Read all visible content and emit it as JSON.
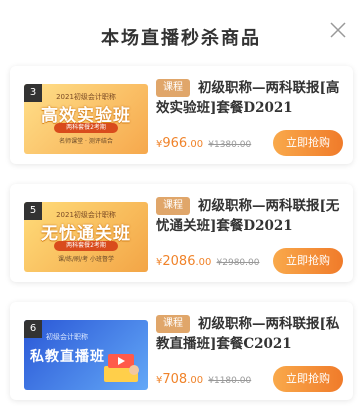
{
  "header": {
    "title": "本场直播秒杀商品"
  },
  "colors": {
    "accent": "#f0832a",
    "tag_bg": "#e0a66a",
    "button_start": "#f9a94b",
    "button_end": "#f07b2a"
  },
  "products": [
    {
      "index": "3",
      "thumb_line1": "2021初级会计职称",
      "thumb_main": "高效实验班",
      "thumb_pill": "两科套餐2考期",
      "thumb_sub": "名师课堂 · 测评结合",
      "thumb_colors": [
        "#ffd36a",
        "#f7a64a"
      ],
      "thumb_main_color": "#f2b21a",
      "tag": "课程",
      "name": "初级职称—两科联报[高效实验班]套餐D2021",
      "price_currency": "¥",
      "price_int": "966",
      "price_dec": ".00",
      "original_price": "¥1380.00",
      "buy_label": "立即抢购"
    },
    {
      "index": "5",
      "thumb_line1": "2021初级会计职称",
      "thumb_main": "无忧通关班",
      "thumb_pill": "两科套餐2考期",
      "thumb_sub": "课/练/刷/考 小班督学",
      "thumb_colors": [
        "#ffd36a",
        "#f3a546"
      ],
      "thumb_main_color": "#f2b21a",
      "tag": "课程",
      "name": "初级职称—两科联报[无忧通关班]套餐D2021",
      "price_currency": "¥",
      "price_int": "2086",
      "price_dec": ".00",
      "original_price": "¥2980.00",
      "buy_label": "立即抢购"
    },
    {
      "index": "6",
      "thumb_line1": "初级会计职称",
      "thumb_main": "私教直播班",
      "thumb_pill": "",
      "thumb_sub": "",
      "thumb_colors": [
        "#2d5bd8",
        "#5aa0f5"
      ],
      "thumb_main_color": "#ffffff",
      "tag": "课程",
      "name": "初级职称—两科联报[私教直播班]套餐C2021",
      "price_currency": "¥",
      "price_int": "708",
      "price_dec": ".00",
      "original_price": "¥1180.00",
      "buy_label": "立即抢购"
    }
  ]
}
